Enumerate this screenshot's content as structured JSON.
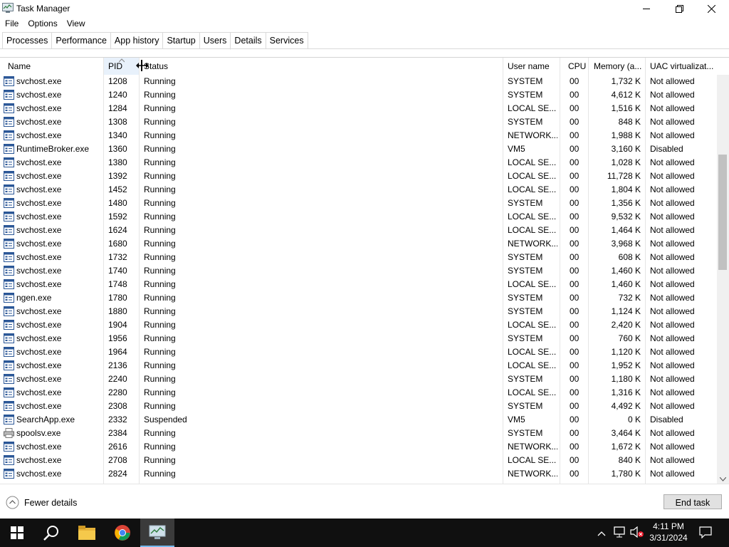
{
  "window": {
    "title": "Task Manager"
  },
  "menu": [
    "File",
    "Options",
    "View"
  ],
  "tabs": [
    "Processes",
    "Performance",
    "App history",
    "Startup",
    "Users",
    "Details",
    "Services"
  ],
  "active_tab": "Details",
  "columns": {
    "name": "Name",
    "pid": "PID",
    "status": "Status",
    "user": "User name",
    "cpu": "CPU",
    "memory": "Memory (a...",
    "uac": "UAC virtualizat..."
  },
  "rows": [
    {
      "name": "svchost.exe",
      "pid": "1208",
      "status": "Running",
      "user": "SYSTEM",
      "cpu": "00",
      "memory": "1,732 K",
      "uac": "Not allowed"
    },
    {
      "name": "svchost.exe",
      "pid": "1240",
      "status": "Running",
      "user": "SYSTEM",
      "cpu": "00",
      "memory": "4,612 K",
      "uac": "Not allowed"
    },
    {
      "name": "svchost.exe",
      "pid": "1284",
      "status": "Running",
      "user": "LOCAL SE...",
      "cpu": "00",
      "memory": "1,516 K",
      "uac": "Not allowed"
    },
    {
      "name": "svchost.exe",
      "pid": "1308",
      "status": "Running",
      "user": "SYSTEM",
      "cpu": "00",
      "memory": "848 K",
      "uac": "Not allowed"
    },
    {
      "name": "svchost.exe",
      "pid": "1340",
      "status": "Running",
      "user": "NETWORK...",
      "cpu": "00",
      "memory": "1,988 K",
      "uac": "Not allowed"
    },
    {
      "name": "RuntimeBroker.exe",
      "pid": "1360",
      "status": "Running",
      "user": "VM5",
      "cpu": "00",
      "memory": "3,160 K",
      "uac": "Disabled"
    },
    {
      "name": "svchost.exe",
      "pid": "1380",
      "status": "Running",
      "user": "LOCAL SE...",
      "cpu": "00",
      "memory": "1,028 K",
      "uac": "Not allowed"
    },
    {
      "name": "svchost.exe",
      "pid": "1392",
      "status": "Running",
      "user": "LOCAL SE...",
      "cpu": "00",
      "memory": "11,728 K",
      "uac": "Not allowed"
    },
    {
      "name": "svchost.exe",
      "pid": "1452",
      "status": "Running",
      "user": "LOCAL SE...",
      "cpu": "00",
      "memory": "1,804 K",
      "uac": "Not allowed"
    },
    {
      "name": "svchost.exe",
      "pid": "1480",
      "status": "Running",
      "user": "SYSTEM",
      "cpu": "00",
      "memory": "1,356 K",
      "uac": "Not allowed"
    },
    {
      "name": "svchost.exe",
      "pid": "1592",
      "status": "Running",
      "user": "LOCAL SE...",
      "cpu": "00",
      "memory": "9,532 K",
      "uac": "Not allowed"
    },
    {
      "name": "svchost.exe",
      "pid": "1624",
      "status": "Running",
      "user": "LOCAL SE...",
      "cpu": "00",
      "memory": "1,464 K",
      "uac": "Not allowed"
    },
    {
      "name": "svchost.exe",
      "pid": "1680",
      "status": "Running",
      "user": "NETWORK...",
      "cpu": "00",
      "memory": "3,968 K",
      "uac": "Not allowed"
    },
    {
      "name": "svchost.exe",
      "pid": "1732",
      "status": "Running",
      "user": "SYSTEM",
      "cpu": "00",
      "memory": "608 K",
      "uac": "Not allowed"
    },
    {
      "name": "svchost.exe",
      "pid": "1740",
      "status": "Running",
      "user": "SYSTEM",
      "cpu": "00",
      "memory": "1,460 K",
      "uac": "Not allowed"
    },
    {
      "name": "svchost.exe",
      "pid": "1748",
      "status": "Running",
      "user": "LOCAL SE...",
      "cpu": "00",
      "memory": "1,460 K",
      "uac": "Not allowed"
    },
    {
      "name": "ngen.exe",
      "pid": "1780",
      "status": "Running",
      "user": "SYSTEM",
      "cpu": "00",
      "memory": "732 K",
      "uac": "Not allowed"
    },
    {
      "name": "svchost.exe",
      "pid": "1880",
      "status": "Running",
      "user": "SYSTEM",
      "cpu": "00",
      "memory": "1,124 K",
      "uac": "Not allowed"
    },
    {
      "name": "svchost.exe",
      "pid": "1904",
      "status": "Running",
      "user": "LOCAL SE...",
      "cpu": "00",
      "memory": "2,420 K",
      "uac": "Not allowed"
    },
    {
      "name": "svchost.exe",
      "pid": "1956",
      "status": "Running",
      "user": "SYSTEM",
      "cpu": "00",
      "memory": "760 K",
      "uac": "Not allowed"
    },
    {
      "name": "svchost.exe",
      "pid": "1964",
      "status": "Running",
      "user": "LOCAL SE...",
      "cpu": "00",
      "memory": "1,120 K",
      "uac": "Not allowed"
    },
    {
      "name": "svchost.exe",
      "pid": "2136",
      "status": "Running",
      "user": "LOCAL SE...",
      "cpu": "00",
      "memory": "1,952 K",
      "uac": "Not allowed"
    },
    {
      "name": "svchost.exe",
      "pid": "2240",
      "status": "Running",
      "user": "SYSTEM",
      "cpu": "00",
      "memory": "1,180 K",
      "uac": "Not allowed"
    },
    {
      "name": "svchost.exe",
      "pid": "2280",
      "status": "Running",
      "user": "LOCAL SE...",
      "cpu": "00",
      "memory": "1,316 K",
      "uac": "Not allowed"
    },
    {
      "name": "svchost.exe",
      "pid": "2308",
      "status": "Running",
      "user": "SYSTEM",
      "cpu": "00",
      "memory": "4,492 K",
      "uac": "Not allowed"
    },
    {
      "name": "SearchApp.exe",
      "pid": "2332",
      "status": "Suspended",
      "user": "VM5",
      "cpu": "00",
      "memory": "0 K",
      "uac": "Disabled"
    },
    {
      "name": "spoolsv.exe",
      "pid": "2384",
      "status": "Running",
      "user": "SYSTEM",
      "cpu": "00",
      "memory": "3,464 K",
      "uac": "Not allowed",
      "icon": "printer-icon"
    },
    {
      "name": "svchost.exe",
      "pid": "2616",
      "status": "Running",
      "user": "NETWORK...",
      "cpu": "00",
      "memory": "1,672 K",
      "uac": "Not allowed"
    },
    {
      "name": "svchost.exe",
      "pid": "2708",
      "status": "Running",
      "user": "LOCAL SE...",
      "cpu": "00",
      "memory": "840 K",
      "uac": "Not allowed"
    },
    {
      "name": "svchost.exe",
      "pid": "2824",
      "status": "Running",
      "user": "NETWORK...",
      "cpu": "00",
      "memory": "1,780 K",
      "uac": "Not allowed"
    }
  ],
  "footer": {
    "fewer_details": "Fewer details",
    "end_task": "End task"
  },
  "taskbar": {
    "time": "4:11 PM",
    "date": "3/31/2024",
    "pinned": [
      "windows-start",
      "search",
      "file-explorer",
      "chrome",
      "task-manager"
    ]
  },
  "colors": {
    "taskbar": "#101010",
    "accent": "#0078d7"
  }
}
